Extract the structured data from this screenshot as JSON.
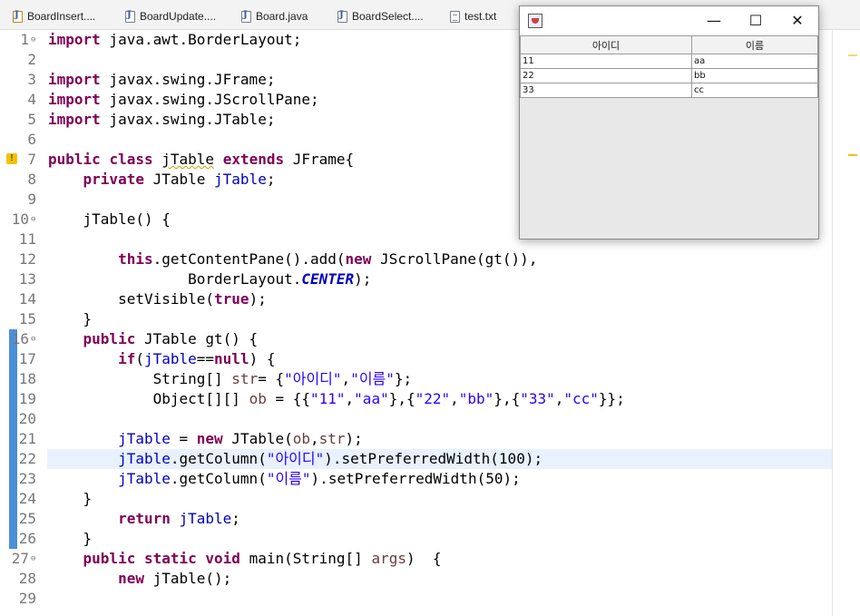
{
  "tabs": [
    {
      "label": "BoardInsert...."
    },
    {
      "label": "BoardUpdate...."
    },
    {
      "label": "Board.java"
    },
    {
      "label": "BoardSelect...."
    },
    {
      "label": "test.txt"
    }
  ],
  "code_lines": [
    {
      "n": "1"
    },
    {
      "n": "2"
    },
    {
      "n": "3"
    },
    {
      "n": "4"
    },
    {
      "n": "5"
    },
    {
      "n": "6"
    },
    {
      "n": "7"
    },
    {
      "n": "8"
    },
    {
      "n": "9"
    },
    {
      "n": "10"
    },
    {
      "n": "11"
    },
    {
      "n": "12"
    },
    {
      "n": "13"
    },
    {
      "n": "14"
    },
    {
      "n": "15"
    },
    {
      "n": "16"
    },
    {
      "n": "17"
    },
    {
      "n": "18"
    },
    {
      "n": "19"
    },
    {
      "n": "20"
    },
    {
      "n": "21"
    },
    {
      "n": "22"
    },
    {
      "n": "23"
    },
    {
      "n": "24"
    },
    {
      "n": "25"
    },
    {
      "n": "26"
    },
    {
      "n": "27"
    },
    {
      "n": "28"
    },
    {
      "n": "29"
    }
  ],
  "code_text": {
    "l1_kw": "import",
    "l1_rest": " java.awt.BorderLayout;",
    "l3_kw": "import",
    "l3_rest": " javax.swing.JFrame;",
    "l4_kw": "import",
    "l4_rest": " javax.swing.JScrollPane;",
    "l5_kw": "import",
    "l5_rest": " javax.swing.JTable;",
    "l7_kw1": "public",
    "l7_kw2": "class",
    "l7_name": "jTable",
    "l7_kw3": "extends",
    "l7_rest": " JFrame{",
    "l8_kw": "private",
    "l8_type": " JTable ",
    "l8_fld": "jTable",
    "l8_end": ";",
    "l10": "jTable() {",
    "l12_kw1": "this",
    "l12_mid": ".getContentPane().add(",
    "l12_kw2": "new",
    "l12_end": " JScrollPane(gt()),",
    "l13_pre": "BorderLayout.",
    "l13_sfld": "CENTER",
    "l13_end": ");",
    "l14_pre": "setVisible(",
    "l14_kw": "true",
    "l14_end": ");",
    "l15": "}",
    "l16_kw": "public",
    "l16_rest": " JTable gt() {",
    "l17_kw1": "if",
    "l17_p": "(",
    "l17_fld": "jTable",
    "l17_op": "==",
    "l17_kw2": "null",
    "l17_end": ") {",
    "l18_pre": "String[] ",
    "l18_loc": "str",
    "l18_mid": "= {",
    "l18_s1": "\"아이디\"",
    "l18_c": ",",
    "l18_s2": "\"이름\"",
    "l18_end": "};",
    "l19_pre": "Object[][] ",
    "l19_loc": "ob",
    "l19_mid": " = {{",
    "l19_s1": "\"11\"",
    "l19_s2": "\"aa\"",
    "l19_s3": "\"22\"",
    "l19_s4": "\"bb\"",
    "l19_s5": "\"33\"",
    "l19_s6": "\"cc\"",
    "l19_end": "}};",
    "l21_fld": "jTable",
    "l21_mid": " = ",
    "l21_kw": "new",
    "l21_a": " JTable(",
    "l21_loc1": "ob",
    "l21_c": ",",
    "l21_loc2": "str",
    "l21_end": ");",
    "l22_fld": "jTable",
    "l22_mid": ".getColumn(",
    "l22_s": "\"아이디\"",
    "l22_end": ").setPreferredWidth(100);",
    "l23_fld": "jTable",
    "l23_mid": ".getColumn(",
    "l23_s": "\"이름\"",
    "l23_end": ").setPreferredWidth(50);",
    "l24": "}",
    "l25_kw": "return",
    "l25_sp": " ",
    "l25_fld": "jTable",
    "l25_end": ";",
    "l26": "}",
    "l27_kw1": "public",
    "l27_kw2": "static",
    "l27_kw3": "void",
    "l27_mid": " main(String[] ",
    "l27_loc": "args",
    "l27_end": ")  {",
    "l28_kw": "new",
    "l28_end": " jTable();"
  },
  "swing_window": {
    "min_glyph": "—",
    "max_glyph": "☐",
    "close_glyph": "✕",
    "columns": [
      "아이디",
      "이름"
    ],
    "rows": [
      [
        "11",
        "aa"
      ],
      [
        "22",
        "bb"
      ],
      [
        "33",
        "cc"
      ]
    ]
  },
  "colors": {
    "keyword": "#7f0055",
    "string": "#2a00ff",
    "field": "#0000c0",
    "change_ruler": "#4a90d9"
  }
}
